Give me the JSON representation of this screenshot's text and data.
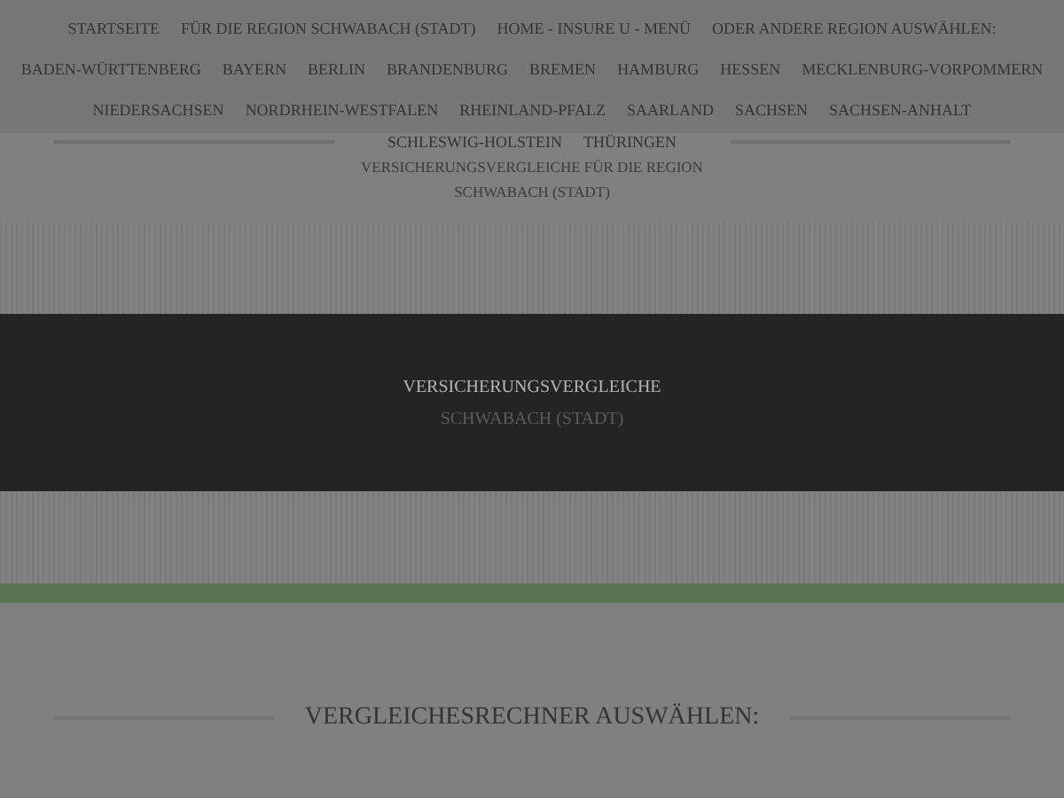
{
  "menu_rows": [
    [
      "STARTSEITE",
      "FÜR DIE REGION SCHWABACH (STADT)",
      "HOME - INSURE U - MENÜ",
      "ODER ANDERE REGION AUSWÄHLEN:"
    ],
    [
      "BADEN-WÜRTTENBERG",
      "BAYERN",
      "BERLIN",
      "BRANDENBURG",
      "BREMEN",
      "HAMBURG",
      "HESSEN",
      "MECKLENBURG-VORPOMMERN"
    ],
    [
      "NIEDERSACHSEN",
      "NORDRHEIN-WESTFALEN",
      "RHEINLAND-PFALZ",
      "SAARLAND",
      "SACHSEN",
      "SACHSEN-ANHALT"
    ],
    [
      "SCHLESWIG-HOLSTEIN",
      "THÜRINGEN"
    ]
  ],
  "site_subtitle": [
    "VERSICHERUNGSVERGLEICHE FÜR DIE REGION",
    "SCHWABACH (STADT)"
  ],
  "hero": {
    "title": "VERSICHERUNGSVERGLEICHE",
    "subtitle": "SCHWABACH (STADT)"
  },
  "section_heading": "VERGLEICHESRECHNER AUSWÄHLEN:"
}
